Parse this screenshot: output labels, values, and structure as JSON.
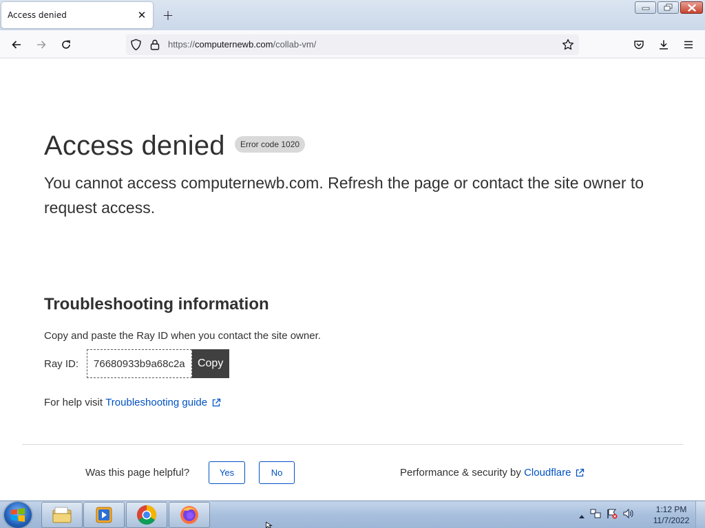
{
  "browser": {
    "tab_title": "Access denied",
    "tab_close": "✕",
    "new_tab": "+",
    "url_scheme": "https://",
    "url_host": "computernewb.com",
    "url_path": "/collab-vm/",
    "icons": [
      "back-icon",
      "forward-icon",
      "reload-icon",
      "shield-icon",
      "lock-icon",
      "star-icon",
      "pocket-icon",
      "download-icon",
      "menu-icon"
    ]
  },
  "page": {
    "title": "Access denied",
    "error_badge": "Error code 1020",
    "lead": "You cannot access computernewb.com. Refresh the page or contact the site owner to request access.",
    "troubleshooting_heading": "Troubleshooting information",
    "copy_hint": "Copy and paste the Ray ID when you contact the site owner.",
    "ray_label": "Ray ID:",
    "ray_id": "76680933b9a68c2a",
    "copy_label": "Copy",
    "help_prefix": "For help visit",
    "help_link": "Troubleshooting guide",
    "helpful_question": "Was this page helpful?",
    "yes_label": "Yes",
    "no_label": "No",
    "perf_prefix": "Performance & security by",
    "perf_link": "Cloudflare"
  },
  "taskbar": {
    "apps": [
      "explorer-icon",
      "media-player-icon",
      "chrome-icon",
      "firefox-icon"
    ],
    "clock_time": "1:12 PM",
    "clock_date": "11/7/2022"
  },
  "colors": {
    "link": "#0051c3",
    "text": "#313131",
    "copy_button": "#404040"
  }
}
